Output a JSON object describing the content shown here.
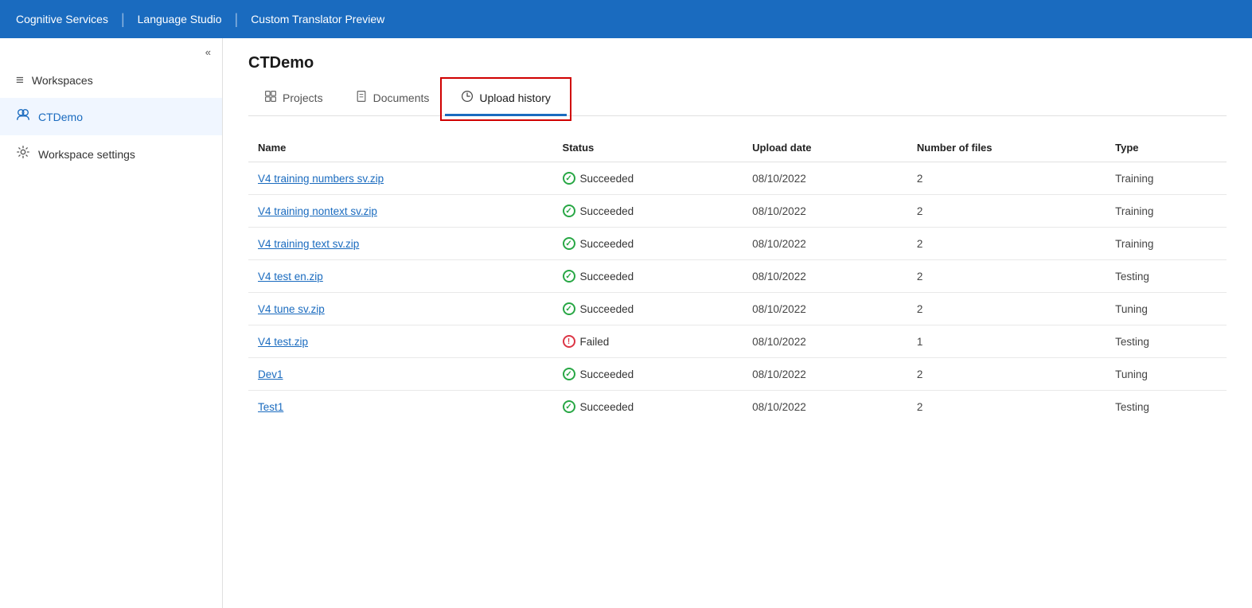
{
  "topnav": {
    "items": [
      {
        "label": "Cognitive Services",
        "id": "cognitive-services"
      },
      {
        "label": "Language Studio",
        "id": "language-studio"
      },
      {
        "label": "Custom Translator Preview",
        "id": "custom-translator"
      }
    ]
  },
  "sidebar": {
    "collapse_label": "«",
    "items": [
      {
        "id": "workspaces",
        "label": "Workspaces",
        "icon": "≡",
        "active": false
      },
      {
        "id": "ctdemo",
        "label": "CTDemo",
        "icon": "👥",
        "active": true
      },
      {
        "id": "workspace-settings",
        "label": "Workspace settings",
        "icon": "⚙",
        "active": false
      }
    ]
  },
  "workspace": {
    "title": "CTDemo"
  },
  "tabs": [
    {
      "id": "projects",
      "label": "Projects",
      "icon": "🔧",
      "active": false
    },
    {
      "id": "documents",
      "label": "Documents",
      "icon": "📄",
      "active": false
    },
    {
      "id": "upload-history",
      "label": "Upload history",
      "icon": "🕐",
      "active": true
    }
  ],
  "table": {
    "columns": [
      {
        "id": "name",
        "label": "Name"
      },
      {
        "id": "status",
        "label": "Status"
      },
      {
        "id": "upload-date",
        "label": "Upload date"
      },
      {
        "id": "num-files",
        "label": "Number of files"
      },
      {
        "id": "type",
        "label": "Type"
      }
    ],
    "rows": [
      {
        "name": "V4 training numbers sv.zip",
        "status": "Succeeded",
        "status_type": "success",
        "upload_date": "08/10/2022",
        "num_files": "2",
        "type": "Training"
      },
      {
        "name": "V4 training nontext sv.zip",
        "status": "Succeeded",
        "status_type": "success",
        "upload_date": "08/10/2022",
        "num_files": "2",
        "type": "Training"
      },
      {
        "name": "V4 training text sv.zip",
        "status": "Succeeded",
        "status_type": "success",
        "upload_date": "08/10/2022",
        "num_files": "2",
        "type": "Training"
      },
      {
        "name": "V4 test en.zip",
        "status": "Succeeded",
        "status_type": "success",
        "upload_date": "08/10/2022",
        "num_files": "2",
        "type": "Testing"
      },
      {
        "name": "V4 tune sv.zip",
        "status": "Succeeded",
        "status_type": "success",
        "upload_date": "08/10/2022",
        "num_files": "2",
        "type": "Tuning"
      },
      {
        "name": "V4 test.zip",
        "status": "Failed",
        "status_type": "failed",
        "upload_date": "08/10/2022",
        "num_files": "1",
        "type": "Testing"
      },
      {
        "name": "Dev1",
        "status": "Succeeded",
        "status_type": "success",
        "upload_date": "08/10/2022",
        "num_files": "2",
        "type": "Tuning"
      },
      {
        "name": "Test1",
        "status": "Succeeded",
        "status_type": "success",
        "upload_date": "08/10/2022",
        "num_files": "2",
        "type": "Testing"
      }
    ]
  }
}
